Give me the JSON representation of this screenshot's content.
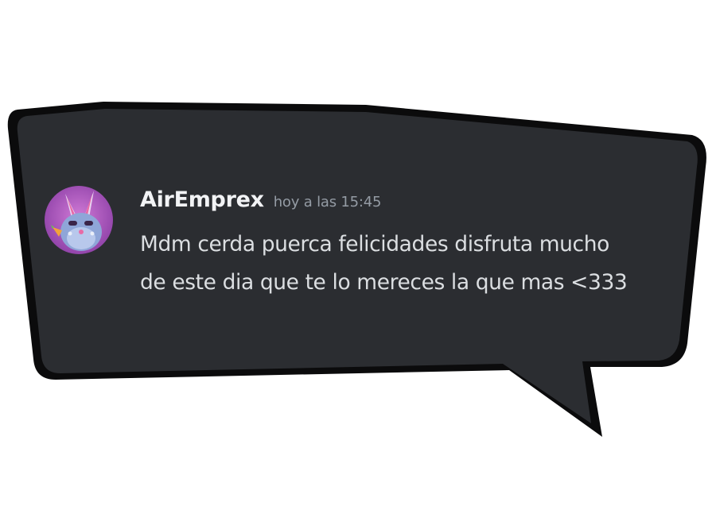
{
  "message": {
    "username": "AirEmprex",
    "timestamp": "hoy a las 15:45",
    "text_line1": "Mdm cerda puerca felicidades disfruta mucho",
    "text_line2": "de este dia que te lo mereces la que mas <333",
    "avatar_icon": "bunny-avatar-icon"
  },
  "colors": {
    "bubble_fill": "#2b2d31",
    "bubble_outline": "#0b0b0c",
    "username": "#f2f3f5",
    "timestamp": "#949ba4",
    "text": "#dbdee1",
    "avatar_bg": "#b05bc4"
  }
}
